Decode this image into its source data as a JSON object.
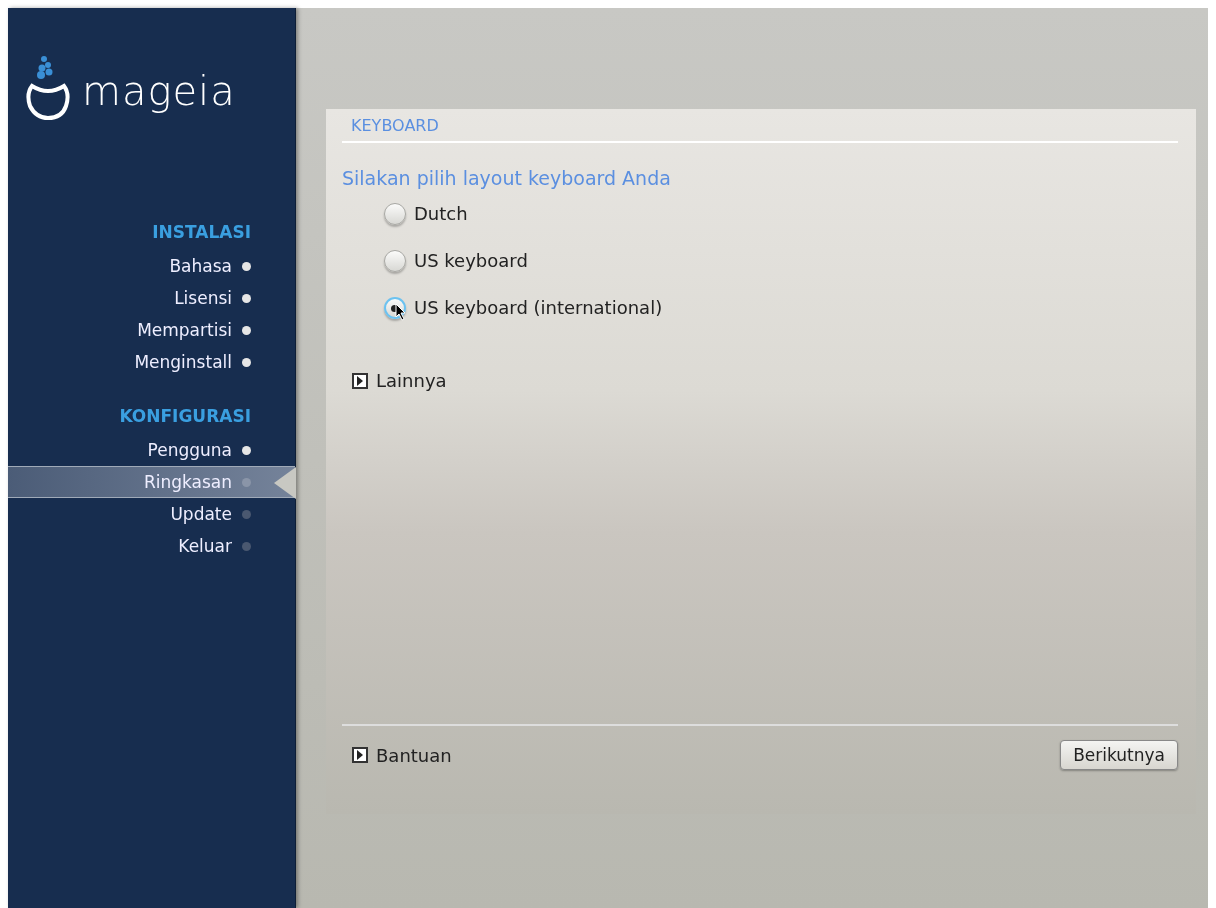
{
  "logo": {
    "text": "mageia"
  },
  "sidebar": {
    "sections": [
      {
        "title": "INSTALASI",
        "items": [
          {
            "label": "Bahasa",
            "done": true,
            "selected": false
          },
          {
            "label": "Lisensi",
            "done": true,
            "selected": false
          },
          {
            "label": "Mempartisi",
            "done": true,
            "selected": false
          },
          {
            "label": "Menginstall",
            "done": true,
            "selected": false
          }
        ]
      },
      {
        "title": "KONFIGURASI",
        "items": [
          {
            "label": "Pengguna",
            "done": true,
            "selected": false
          },
          {
            "label": "Ringkasan",
            "done": false,
            "selected": true
          },
          {
            "label": "Update",
            "done": false,
            "selected": false
          },
          {
            "label": "Keluar",
            "done": false,
            "selected": false
          }
        ]
      }
    ]
  },
  "panel": {
    "title": "KEYBOARD",
    "prompt": "Silakan pilih layout keyboard Anda",
    "options": [
      {
        "label": "Dutch",
        "selected": false
      },
      {
        "label": "US keyboard",
        "selected": false
      },
      {
        "label": "US keyboard (international)",
        "selected": true
      }
    ],
    "expander": {
      "label": "Lainnya",
      "expanded": false
    },
    "help": {
      "label": "Bantuan",
      "expanded": false
    },
    "next_button": "Berikutnya"
  }
}
